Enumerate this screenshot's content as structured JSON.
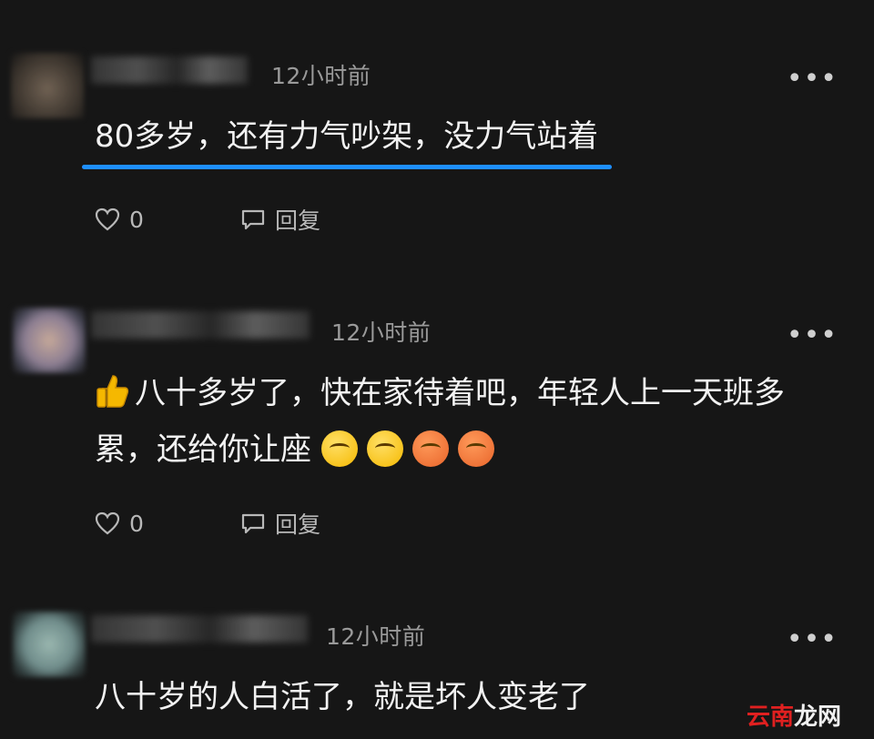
{
  "comments": [
    {
      "time": "12小时前",
      "more": "•••",
      "text": "80多岁，还有力气吵架，没力气站着",
      "likes": "0",
      "reply_label": "回复"
    },
    {
      "time": "12小时前",
      "more": "•••",
      "text_line1": "八十多岁了，快在家待着吧，年轻人上一天班多",
      "text_line2": "累，还给你让座",
      "likes": "0",
      "reply_label": "回复"
    },
    {
      "time": "12小时前",
      "more": "•••",
      "text": "八十岁的人白活了，就是坏人变老了"
    }
  ],
  "watermark": {
    "part1": "云南",
    "part2": "龙网"
  },
  "colors": {
    "background": "#161616",
    "highlight": "#1e8fff"
  }
}
